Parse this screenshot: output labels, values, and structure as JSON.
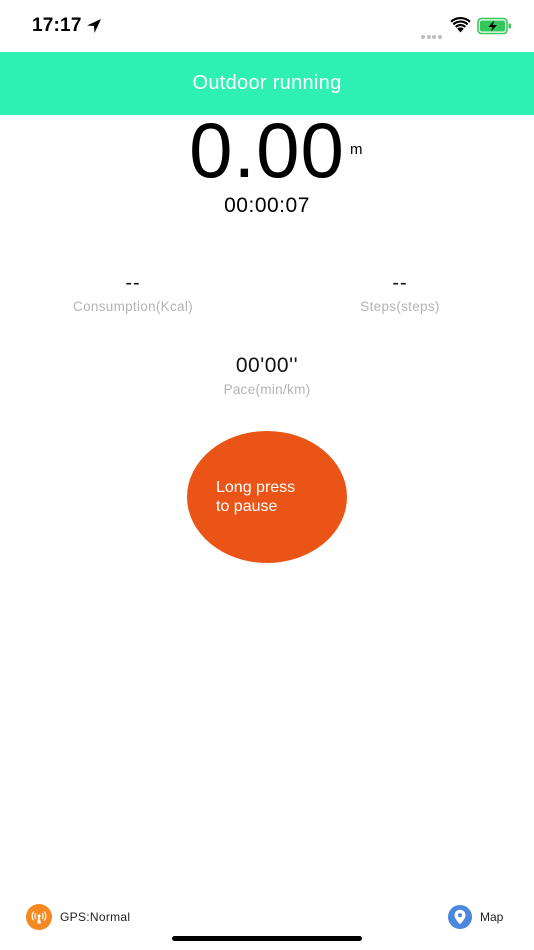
{
  "status_bar": {
    "time": "17:17",
    "icons": [
      "location-arrow-icon",
      "cellular-signal-icon",
      "wifi-icon",
      "battery-charging-icon"
    ],
    "battery_color": "#34c759"
  },
  "header": {
    "title": "Outdoor running",
    "background_color": "#2ef0b2"
  },
  "workout": {
    "distance": "0.00",
    "distance_unit": "m",
    "elapsed_time": "00:00:07"
  },
  "stats": {
    "consumption": {
      "value": "--",
      "label": "Consumption(Kcal)"
    },
    "steps": {
      "value": "--",
      "label": "Steps(steps)"
    },
    "pace": {
      "value": "00'00''",
      "label": "Pace(min/km)"
    }
  },
  "pause_button": {
    "label_line1": "Long press",
    "label_line2": "to pause",
    "color": "#ea5517"
  },
  "footer": {
    "gps_label": "GPS:Normal",
    "gps_icon": "gps-signal-icon",
    "gps_color": "#f5891f",
    "map_label": "Map",
    "map_icon": "map-pin-icon",
    "map_color": "#4b86df"
  }
}
